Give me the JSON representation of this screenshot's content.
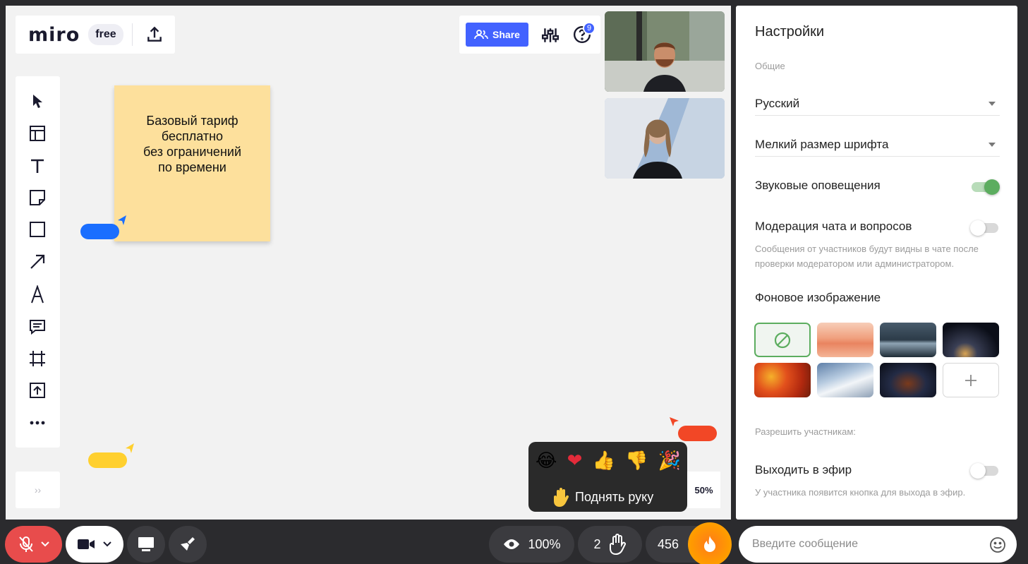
{
  "app": {
    "logo": "miro",
    "plan_badge": "free"
  },
  "header": {
    "share_label": "Share",
    "help_badge_count": "9"
  },
  "toolbar": {
    "tools": [
      "cursor-icon",
      "templates-icon",
      "text-icon",
      "sticky-note-icon",
      "shape-icon",
      "arrow-icon",
      "pen-icon",
      "comment-icon",
      "frame-icon",
      "upload-icon",
      "more-icon"
    ],
    "expand_label": "››"
  },
  "board": {
    "sticky_text": "Базовый тариф\nбесплатно\nбез ограничений\nпо времени",
    "zoom": "50%"
  },
  "colors": {
    "accent": "#4262ff",
    "toggle_on": "#5cad5f",
    "record": "#e84c4c",
    "fire": "#ff8a00"
  },
  "reactions": {
    "emojis": [
      "😂",
      "❤",
      "👍",
      "👎",
      "🎉"
    ],
    "raise_hand_label": "Поднять руку"
  },
  "settings": {
    "title": "Настройки",
    "general_label": "Общие",
    "language": "Русский",
    "font_size": "Мелкий размер шрифта",
    "sound_label": "Звуковые оповещения",
    "sound_on": true,
    "moderation_label": "Модерация чата и вопросов",
    "moderation_on": false,
    "moderation_hint": "Сообщения от участников будут видны в чате после проверки модератором или администратором.",
    "background_label": "Фоновое изображение",
    "background_options": [
      "none",
      "desert",
      "lake",
      "night-earth",
      "autumn-leaves",
      "snow-mountains",
      "dark-abstract",
      "add"
    ],
    "allow_label": "Разрешить участникам:",
    "broadcast_label": "Выходить в эфир",
    "broadcast_on": false,
    "broadcast_hint": "У участника появится кнопка для выхода в эфир."
  },
  "bottom_bar": {
    "views": "100%",
    "raised_hands": "2",
    "participants": "456",
    "message_placeholder": "Введите сообщение"
  }
}
